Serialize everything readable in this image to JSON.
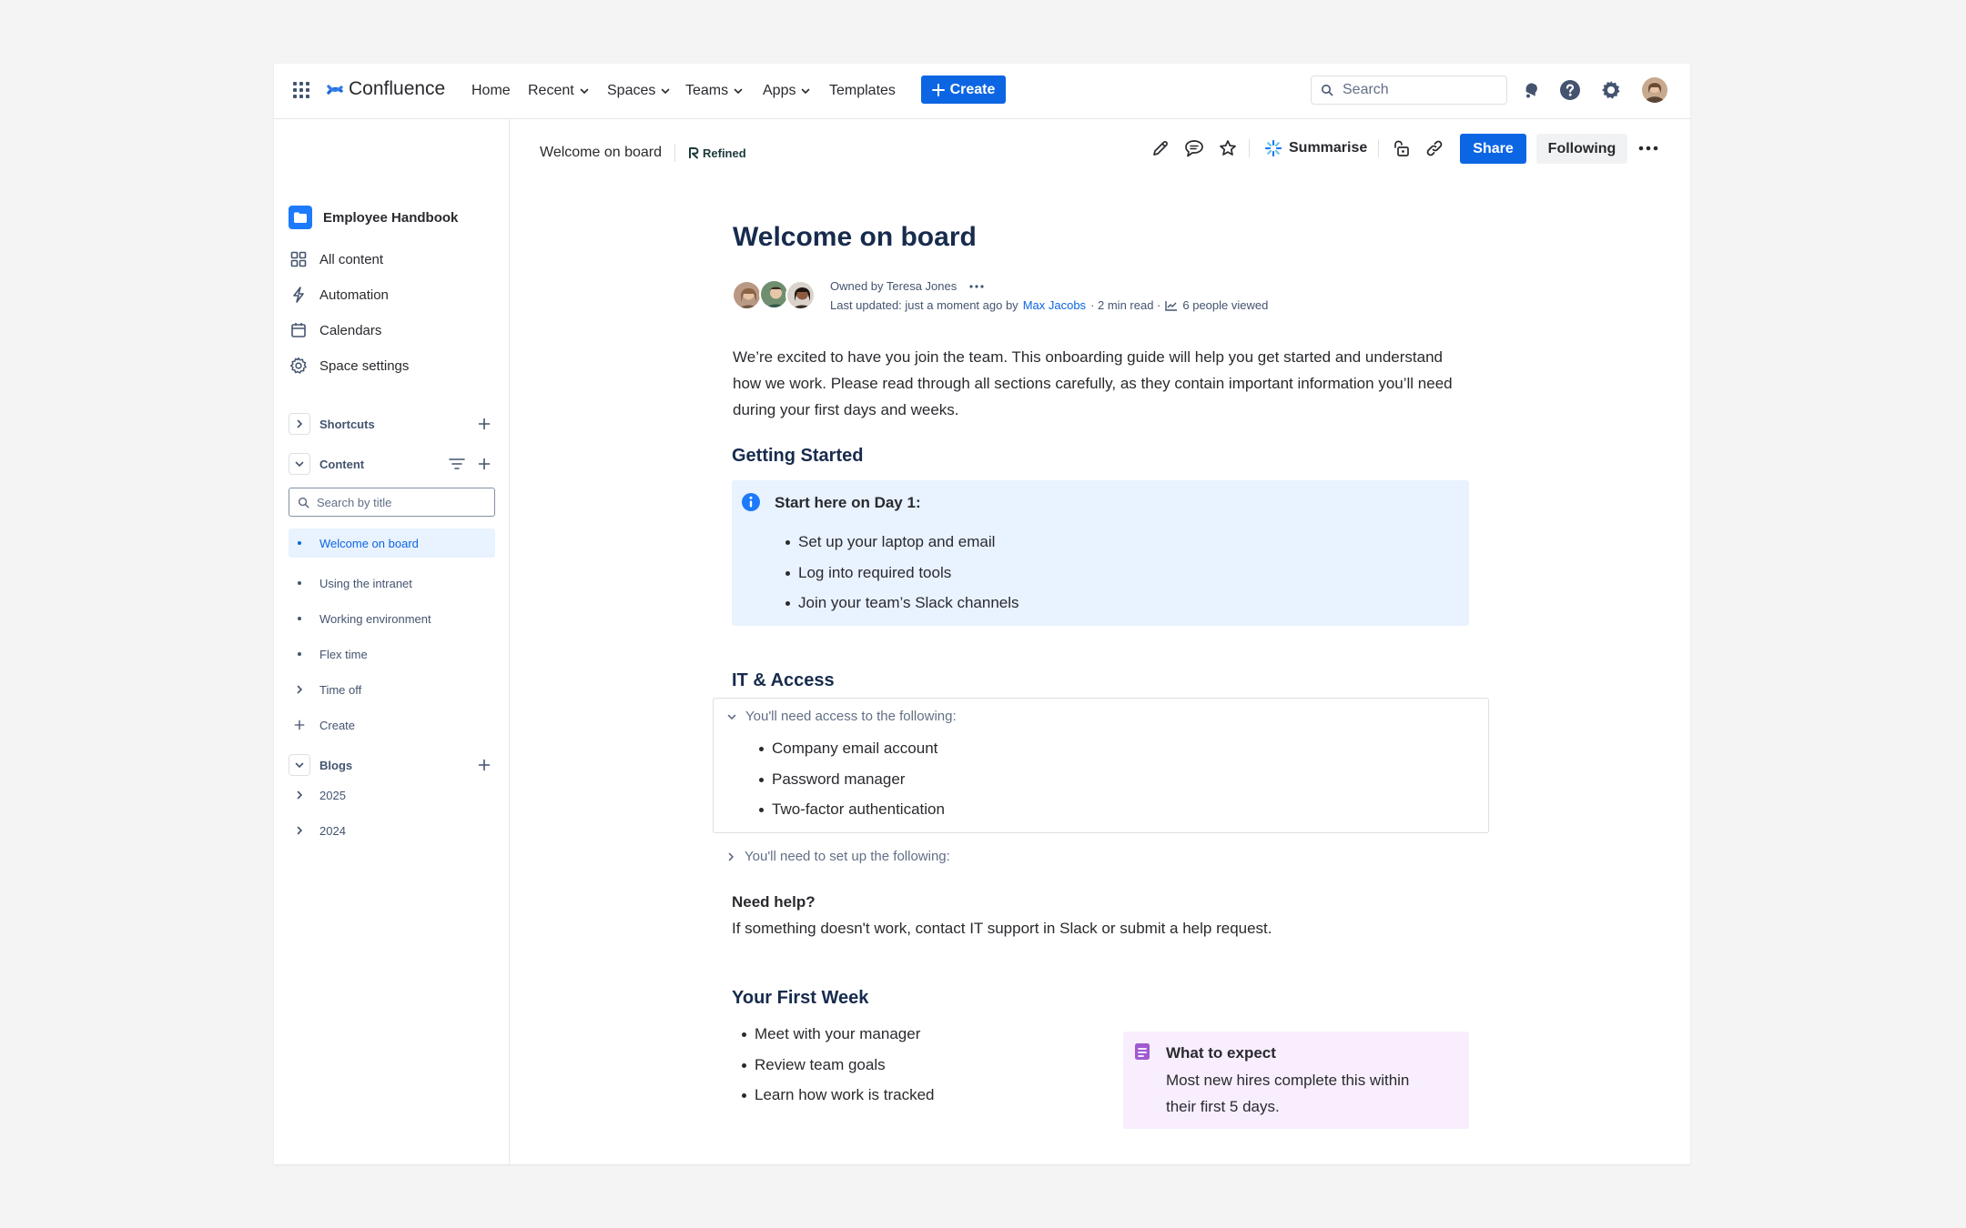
{
  "nav": {
    "product": "Confluence",
    "items": [
      "Home",
      "Recent",
      "Spaces",
      "Teams",
      "Apps",
      "Templates"
    ],
    "create": "Create",
    "search_placeholder": "Search"
  },
  "sidebar": {
    "space_name": "Employee Handbook",
    "items": [
      "All content",
      "Automation",
      "Calendars",
      "Space settings"
    ],
    "shortcuts": "Shortcuts",
    "content": "Content",
    "search_placeholder": "Search by title",
    "tree": [
      "Welcome on board",
      "Using the intranet",
      "Working environment",
      "Flex time",
      "Time off",
      "Create"
    ],
    "blogs": "Blogs",
    "blog_years": [
      "2025",
      "2024"
    ]
  },
  "header": {
    "breadcrumb": "Welcome on board",
    "app_badge": "Refined",
    "summarise": "Summarise",
    "share": "Share",
    "following": "Following"
  },
  "page": {
    "title": "Welcome on board",
    "owner_line": "Owned by Teresa Jones",
    "updated_prefix": "Last updated: just a moment ago by",
    "updated_by": "Max Jacobs",
    "read_time": "· 2 min read ·",
    "views": "6 people viewed",
    "intro": "We’re excited to have you join the team. This onboarding guide will help you get started and understand how we work. Please read through all sections carefully, as they contain important information you’ll need during your first days and weeks.",
    "getting_started": {
      "heading": "Getting Started",
      "panel_title": "Start here on Day 1:",
      "items": [
        "Set up your laptop and email",
        "Log into required tools",
        "Join your team’s Slack channels"
      ]
    },
    "it_access": {
      "heading": "IT & Access",
      "expand_open_title": "You'll need access to the following:",
      "items": [
        "Company email account",
        "Password manager",
        "Two-factor authentication"
      ],
      "expand_closed_title": "You'll need to set up the following:"
    },
    "help": {
      "heading": "Need help?",
      "text": "If something doesn't work, contact IT support in Slack or submit a help request."
    },
    "first_week": {
      "heading": "Your First Week",
      "items": [
        "Meet with your manager",
        "Review team goals",
        "Learn how work is tracked"
      ],
      "note_title": "What to expect",
      "note_text": "Most new hires complete this within their first 5 days."
    }
  },
  "colors": {
    "primary": "#0c66e4",
    "info_panel": "#e9f2ff",
    "note_panel": "#f8eefe",
    "note_icon": "#a05ad1",
    "selected": "#e9f2ff"
  }
}
